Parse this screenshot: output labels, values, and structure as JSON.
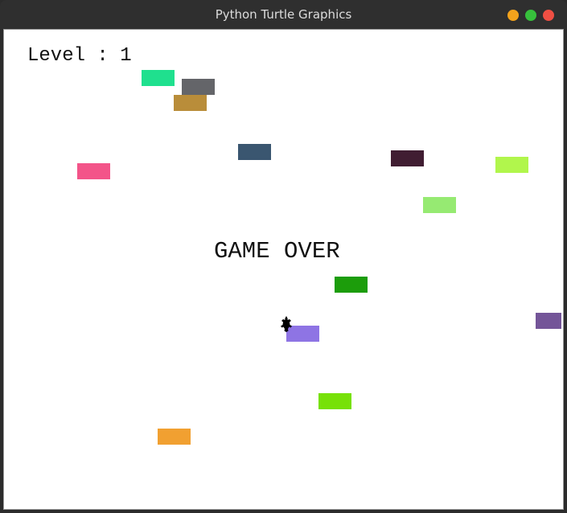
{
  "window": {
    "title": "Python Turtle Graphics",
    "controls": {
      "minimize_color": "#f4a31c",
      "maximize_color": "#37c03c",
      "close_color": "#ef4f43"
    }
  },
  "game": {
    "level_text": "Level : 1",
    "gameover_text": "GAME OVER",
    "player_icon": "turtle-icon",
    "cars": [
      {
        "color": "#1fe08e"
      },
      {
        "color": "#646569"
      },
      {
        "color": "#b98d3a"
      },
      {
        "color": "#3a5670"
      },
      {
        "color": "#f35489"
      },
      {
        "color": "#401d32"
      },
      {
        "color": "#b1f64c"
      },
      {
        "color": "#96ea72"
      },
      {
        "color": "#1c9d0b"
      },
      {
        "color": "#8e74e4"
      },
      {
        "color": "#745598"
      },
      {
        "color": "#77e108"
      },
      {
        "color": "#f1a031"
      }
    ]
  }
}
